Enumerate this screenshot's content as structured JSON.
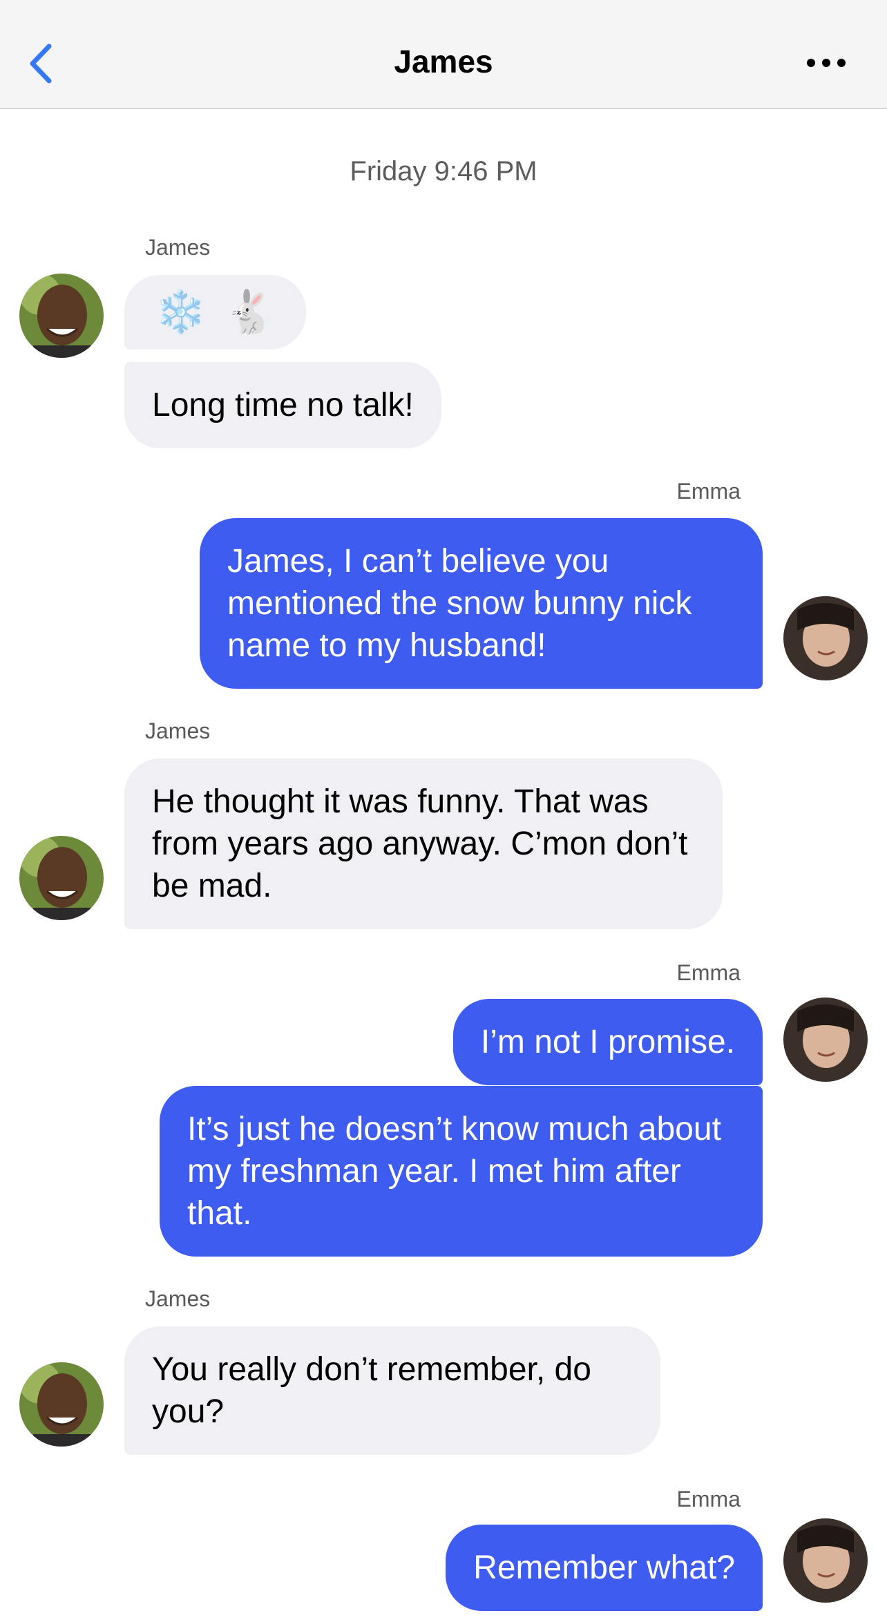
{
  "header": {
    "title": "James",
    "back_icon": "chevron-left-icon",
    "more_icon": "ellipsis-icon",
    "accent": "#3478f6"
  },
  "timestamp": "Friday 9:46 PM",
  "colors": {
    "incoming_bubble": "#efeff4",
    "outgoing_bubble": "#3e5cf0"
  },
  "messages": [
    {
      "sender": "James",
      "emoji": [
        "❄️",
        "🐇"
      ],
      "text": "Long time no talk!"
    },
    {
      "sender": "Emma",
      "text": "James, I can’t believe you mentioned the snow bunny nick name to my husband!"
    },
    {
      "sender": "James",
      "text": "He thought it was funny. That was from years ago anyway. C’mon don’t be mad."
    },
    {
      "sender": "Emma",
      "text": "I’m not I promise.",
      "text2": "It’s just he doesn’t know much about my freshman year. I met him after that."
    },
    {
      "sender": "James",
      "text": "You really don’t remember, do you?"
    },
    {
      "sender": "Emma",
      "text": "Remember what?"
    }
  ]
}
